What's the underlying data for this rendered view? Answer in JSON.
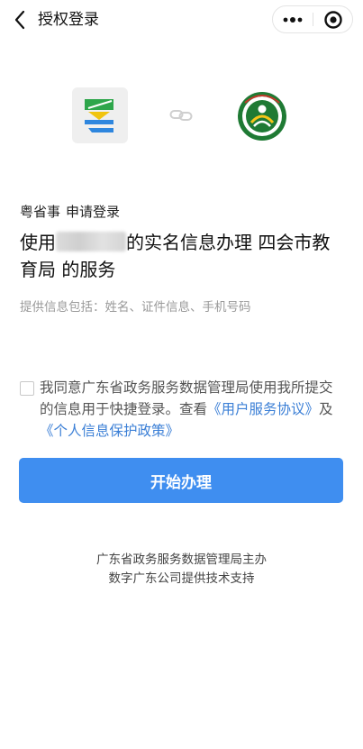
{
  "header": {
    "title": "授权登录"
  },
  "app": {
    "name": "粤省事",
    "action": "申请登录"
  },
  "headline": {
    "prefix": "使用",
    "suffix": "的实名信息办理 四会市教育局 的服务"
  },
  "info": "提供信息包括：姓名、证件信息、手机号码",
  "agreement": {
    "text_before": "我同意广东省政务服务数据管理局使用我所提交的信息用于快捷登录。查看",
    "link1": "《用户服务协议》",
    "joiner": "及",
    "link2": "《个人信息保护政策》"
  },
  "primary_button": "开始办理",
  "footer": {
    "line1": "广东省政务服务数据管理局主办",
    "line2": "数字广东公司提供技术支持"
  },
  "colors": {
    "accent": "#3f8ef0",
    "link": "#3b7fd6",
    "muted": "#9a9a9a"
  }
}
